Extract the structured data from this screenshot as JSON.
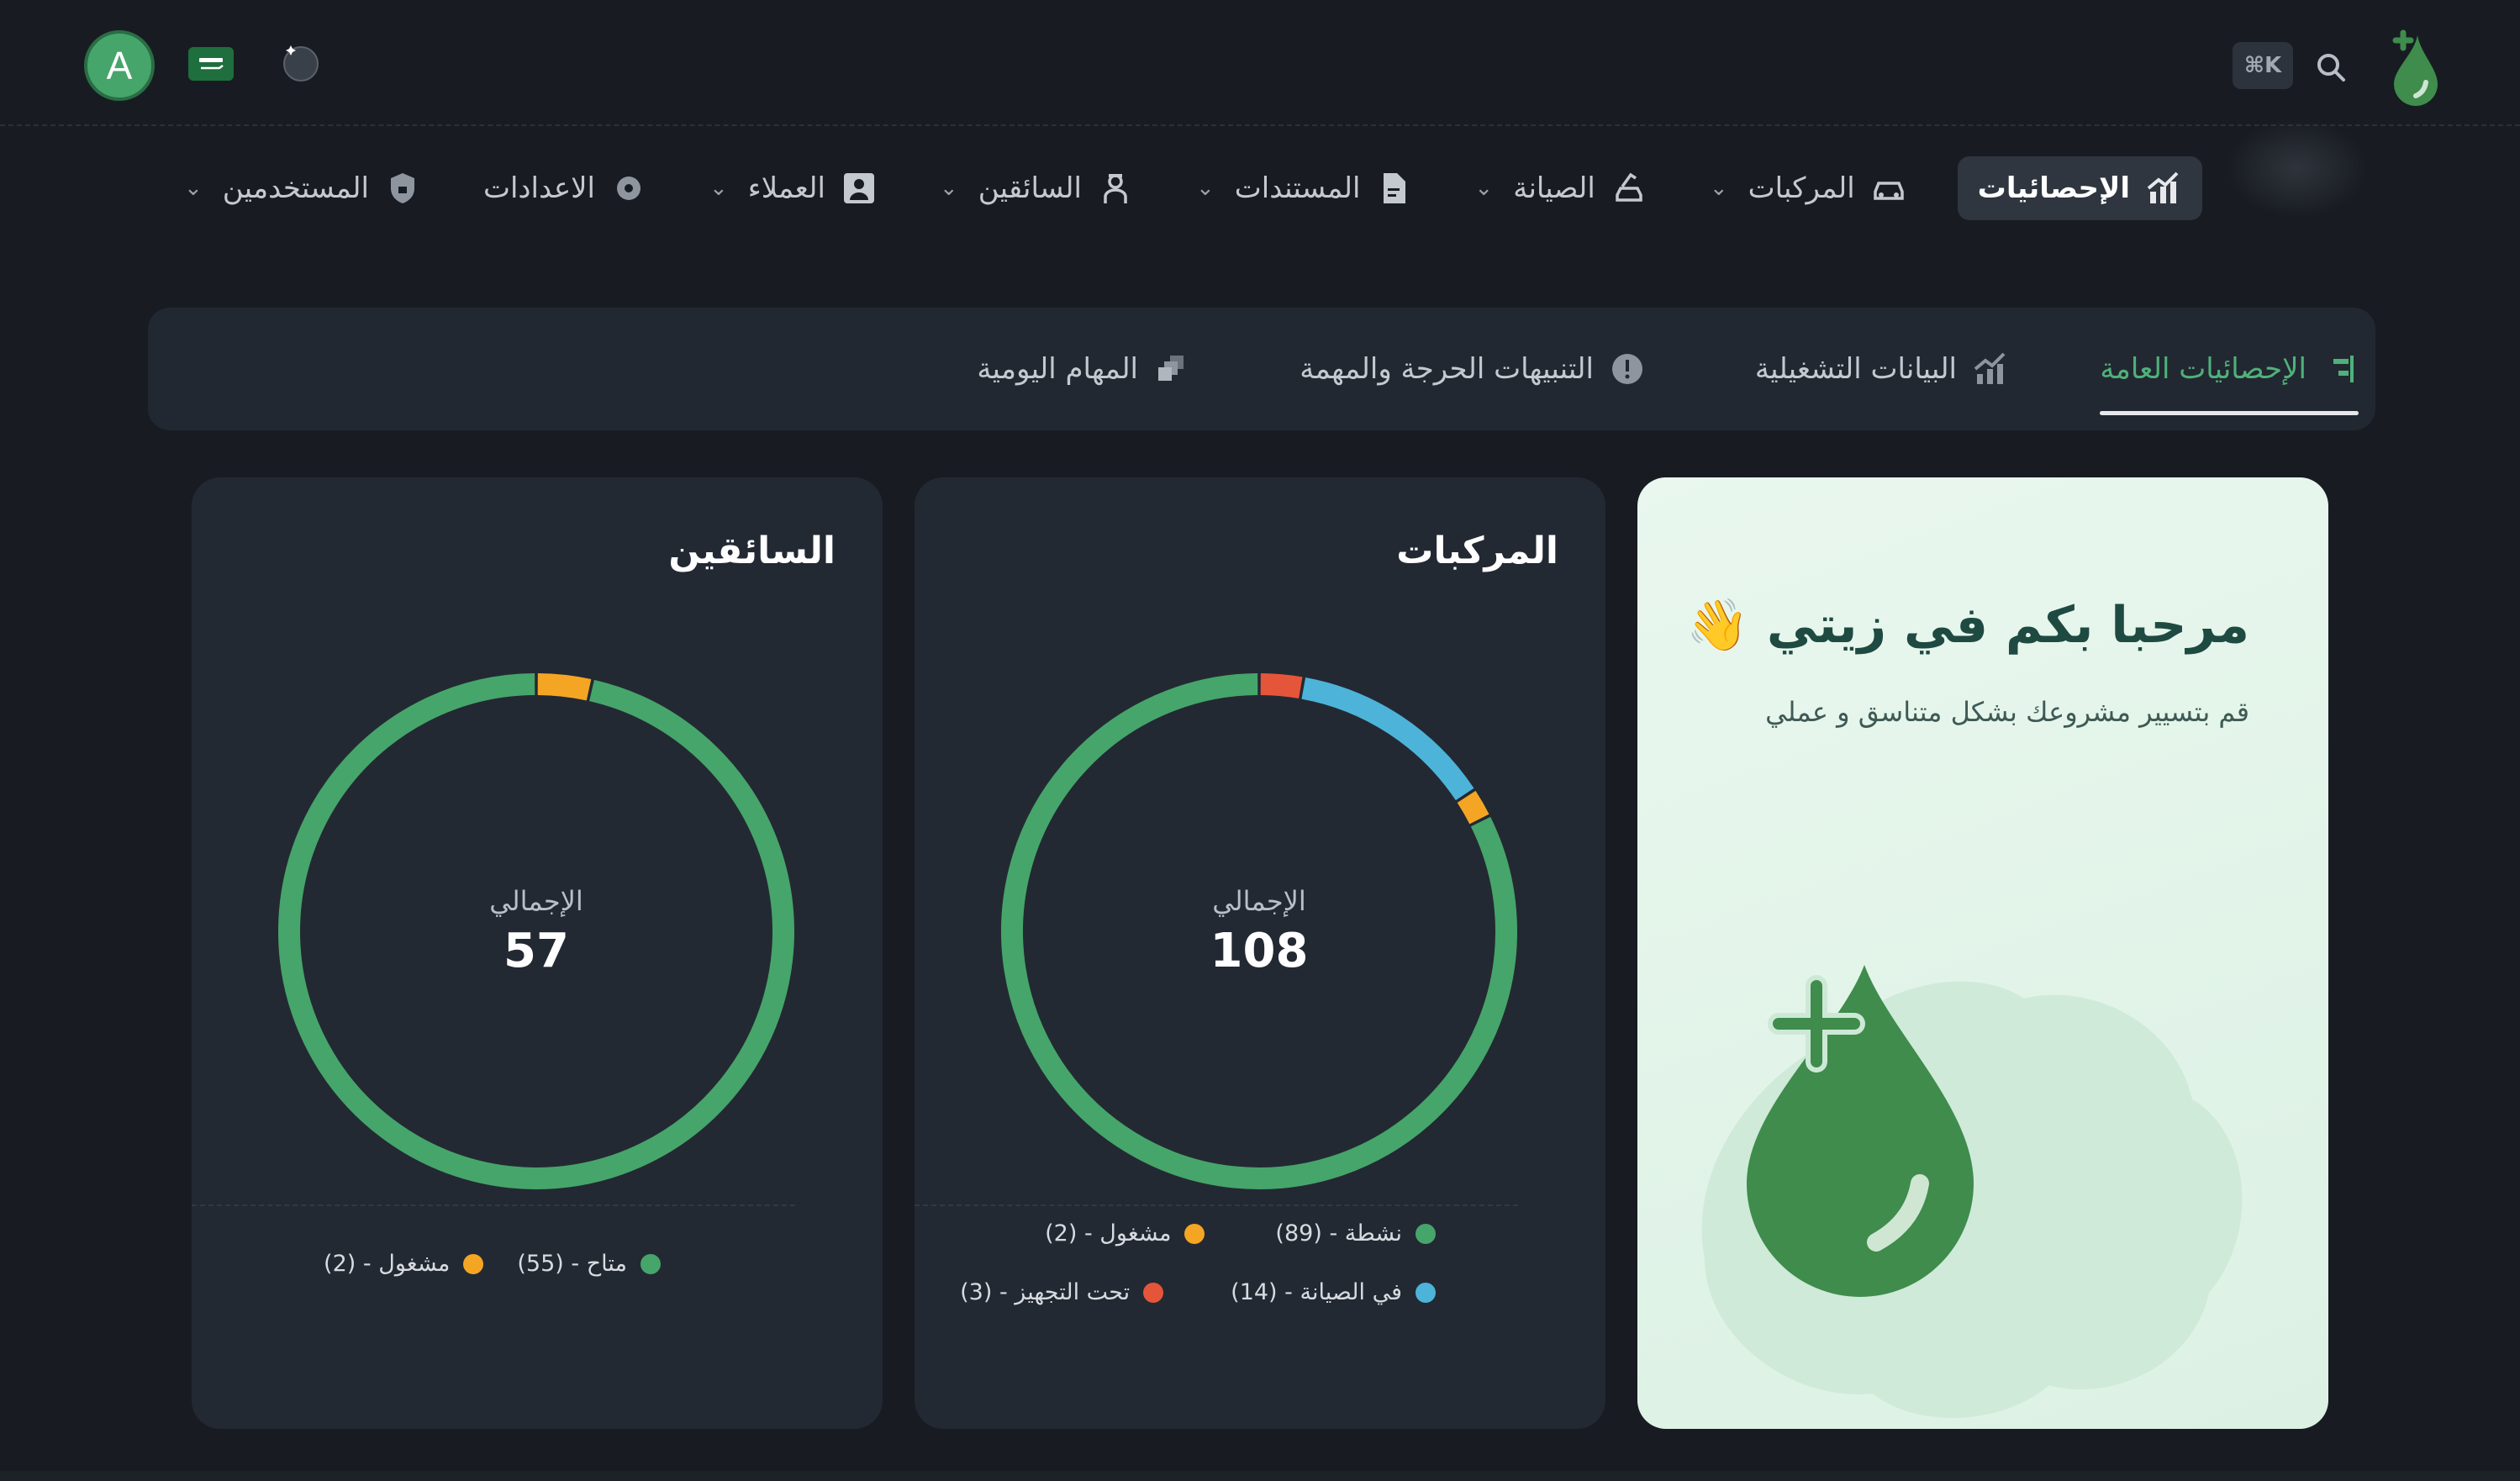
{
  "header": {
    "avatar_initial": "A",
    "search_shortcut": "⌘K",
    "icons": {
      "logo": "oil-drop-plus-logo",
      "search": "search-icon",
      "flag": "saudi-flag-icon",
      "theme": "moon-icon"
    }
  },
  "nav": {
    "items": [
      {
        "label": "الإحصائيات",
        "icon": "chart-icon",
        "active": true
      },
      {
        "label": "المركبات",
        "icon": "car-icon"
      },
      {
        "label": "الصيانة",
        "icon": "car-lift-icon"
      },
      {
        "label": "المستندات",
        "icon": "document-icon"
      },
      {
        "label": "السائقين",
        "icon": "driver-icon"
      },
      {
        "label": "العملاء",
        "icon": "user-icon"
      },
      {
        "label": "الاعدادات",
        "icon": "gear-icon"
      },
      {
        "label": "المستخدمين",
        "icon": "shield-icon"
      }
    ]
  },
  "tabs": [
    {
      "label": "الإحصائيات العامة",
      "icon": "bar-chart-icon",
      "active": true
    },
    {
      "label": "البيانات التشغيلية",
      "icon": "trend-chart-icon"
    },
    {
      "label": "التنبيهات الحرجة والمهمة",
      "icon": "alert-icon"
    },
    {
      "label": "المهام اليومية",
      "icon": "stack-icon"
    }
  ],
  "welcome": {
    "title": "مرحبا بكم في زيتي 👋",
    "subtitle": "قم بتسيير مشروعك بشكل متناسق و عملي"
  },
  "colors": {
    "green": "#46a56a",
    "orange": "#f5a524",
    "blue": "#4db3d9",
    "red": "#e5553a"
  },
  "vehicles": {
    "title": "المركبات",
    "total_label": "الإجمالي",
    "total": "108",
    "legend": {
      "active": "نشطة - (89)",
      "busy": "مشغول - (2)",
      "maintenance": "في الصيانة - (14)",
      "preparing": "تحت التجهيز - (3)"
    }
  },
  "drivers": {
    "title": "السائقين",
    "total_label": "الإجمالي",
    "total": "57",
    "legend": {
      "available": "متاح - (55)",
      "busy": "مشغول - (2)"
    }
  },
  "chart_data": [
    {
      "type": "pie",
      "title": "المركبات",
      "categories": [
        "نشطة",
        "مشغول",
        "في الصيانة",
        "تحت التجهيز"
      ],
      "values": [
        89,
        2,
        14,
        3
      ],
      "colors": [
        "#46a56a",
        "#f5a524",
        "#4db3d9",
        "#e5553a"
      ],
      "total": 108
    },
    {
      "type": "pie",
      "title": "السائقين",
      "categories": [
        "متاح",
        "مشغول"
      ],
      "values": [
        55,
        2
      ],
      "colors": [
        "#46a56a",
        "#f5a524"
      ],
      "total": 57
    }
  ]
}
